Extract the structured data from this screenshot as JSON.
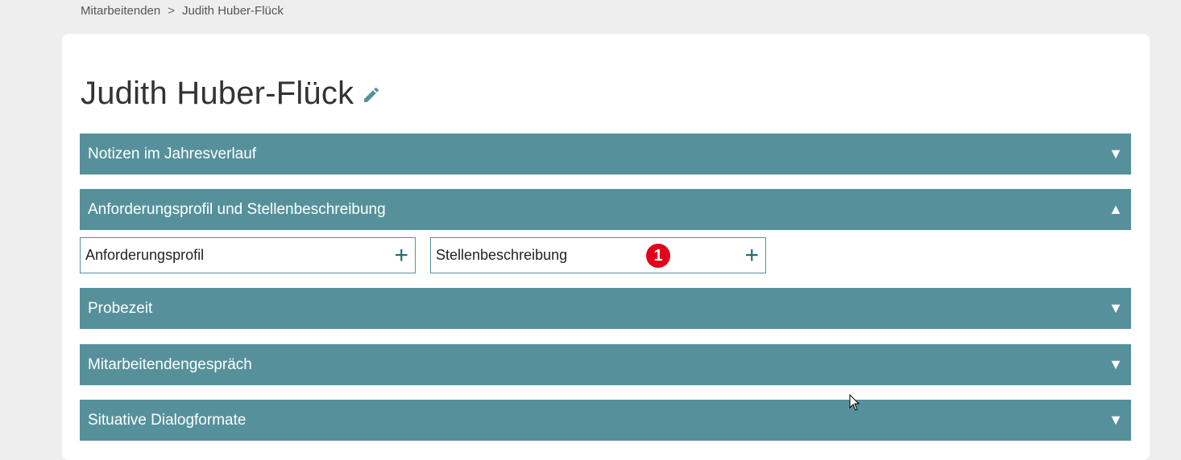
{
  "breadcrumb": {
    "parent": "Mitarbeitenden",
    "separator": ">",
    "current": "Judith Huber-Flück"
  },
  "page": {
    "title": "Judith Huber-Flück",
    "edit_icon": "pencil-icon"
  },
  "sections": [
    {
      "label": "Notizen im Jahresverlauf",
      "arrow": "▼",
      "expanded": false
    },
    {
      "label": "Anforderungsprofil und Stellenbeschreibung",
      "arrow": "▲",
      "expanded": true
    },
    {
      "label": "Probezeit",
      "arrow": "▼",
      "expanded": false
    },
    {
      "label": "Mitarbeitendengespräch",
      "arrow": "▼",
      "expanded": false
    },
    {
      "label": "Situative Dialogformate",
      "arrow": "▼",
      "expanded": false
    }
  ],
  "sub_items": [
    {
      "label": "Anforderungsprofil",
      "action": "+"
    },
    {
      "label": "Stellenbeschreibung",
      "action": "+",
      "badge": "1"
    }
  ],
  "colors": {
    "accent": "#56919b",
    "badge": "#e3001b",
    "background": "#efeeee"
  }
}
